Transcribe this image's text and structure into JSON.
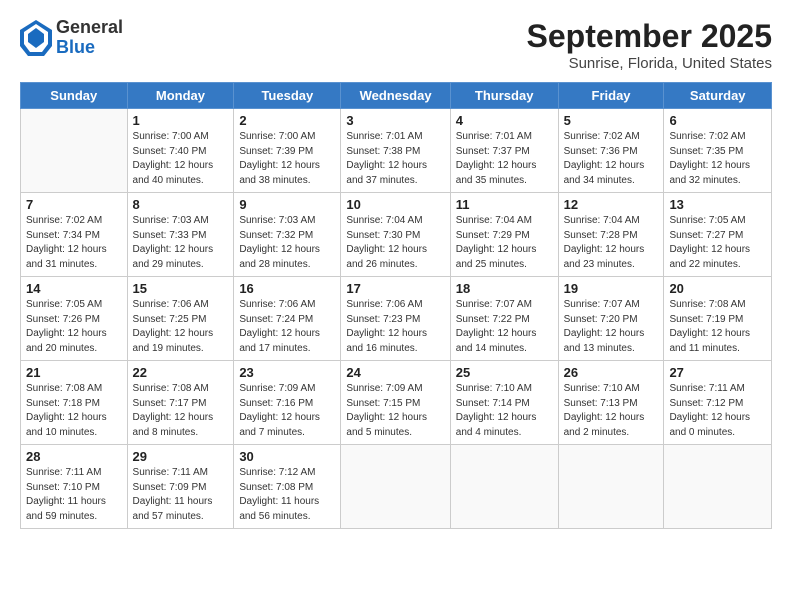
{
  "header": {
    "logo": {
      "general": "General",
      "blue": "Blue"
    },
    "title": "September 2025",
    "subtitle": "Sunrise, Florida, United States"
  },
  "weekdays": [
    "Sunday",
    "Monday",
    "Tuesday",
    "Wednesday",
    "Thursday",
    "Friday",
    "Saturday"
  ],
  "weeks": [
    [
      {
        "day": "",
        "info": ""
      },
      {
        "day": "1",
        "info": "Sunrise: 7:00 AM\nSunset: 7:40 PM\nDaylight: 12 hours\nand 40 minutes."
      },
      {
        "day": "2",
        "info": "Sunrise: 7:00 AM\nSunset: 7:39 PM\nDaylight: 12 hours\nand 38 minutes."
      },
      {
        "day": "3",
        "info": "Sunrise: 7:01 AM\nSunset: 7:38 PM\nDaylight: 12 hours\nand 37 minutes."
      },
      {
        "day": "4",
        "info": "Sunrise: 7:01 AM\nSunset: 7:37 PM\nDaylight: 12 hours\nand 35 minutes."
      },
      {
        "day": "5",
        "info": "Sunrise: 7:02 AM\nSunset: 7:36 PM\nDaylight: 12 hours\nand 34 minutes."
      },
      {
        "day": "6",
        "info": "Sunrise: 7:02 AM\nSunset: 7:35 PM\nDaylight: 12 hours\nand 32 minutes."
      }
    ],
    [
      {
        "day": "7",
        "info": "Sunrise: 7:02 AM\nSunset: 7:34 PM\nDaylight: 12 hours\nand 31 minutes."
      },
      {
        "day": "8",
        "info": "Sunrise: 7:03 AM\nSunset: 7:33 PM\nDaylight: 12 hours\nand 29 minutes."
      },
      {
        "day": "9",
        "info": "Sunrise: 7:03 AM\nSunset: 7:32 PM\nDaylight: 12 hours\nand 28 minutes."
      },
      {
        "day": "10",
        "info": "Sunrise: 7:04 AM\nSunset: 7:30 PM\nDaylight: 12 hours\nand 26 minutes."
      },
      {
        "day": "11",
        "info": "Sunrise: 7:04 AM\nSunset: 7:29 PM\nDaylight: 12 hours\nand 25 minutes."
      },
      {
        "day": "12",
        "info": "Sunrise: 7:04 AM\nSunset: 7:28 PM\nDaylight: 12 hours\nand 23 minutes."
      },
      {
        "day": "13",
        "info": "Sunrise: 7:05 AM\nSunset: 7:27 PM\nDaylight: 12 hours\nand 22 minutes."
      }
    ],
    [
      {
        "day": "14",
        "info": "Sunrise: 7:05 AM\nSunset: 7:26 PM\nDaylight: 12 hours\nand 20 minutes."
      },
      {
        "day": "15",
        "info": "Sunrise: 7:06 AM\nSunset: 7:25 PM\nDaylight: 12 hours\nand 19 minutes."
      },
      {
        "day": "16",
        "info": "Sunrise: 7:06 AM\nSunset: 7:24 PM\nDaylight: 12 hours\nand 17 minutes."
      },
      {
        "day": "17",
        "info": "Sunrise: 7:06 AM\nSunset: 7:23 PM\nDaylight: 12 hours\nand 16 minutes."
      },
      {
        "day": "18",
        "info": "Sunrise: 7:07 AM\nSunset: 7:22 PM\nDaylight: 12 hours\nand 14 minutes."
      },
      {
        "day": "19",
        "info": "Sunrise: 7:07 AM\nSunset: 7:20 PM\nDaylight: 12 hours\nand 13 minutes."
      },
      {
        "day": "20",
        "info": "Sunrise: 7:08 AM\nSunset: 7:19 PM\nDaylight: 12 hours\nand 11 minutes."
      }
    ],
    [
      {
        "day": "21",
        "info": "Sunrise: 7:08 AM\nSunset: 7:18 PM\nDaylight: 12 hours\nand 10 minutes."
      },
      {
        "day": "22",
        "info": "Sunrise: 7:08 AM\nSunset: 7:17 PM\nDaylight: 12 hours\nand 8 minutes."
      },
      {
        "day": "23",
        "info": "Sunrise: 7:09 AM\nSunset: 7:16 PM\nDaylight: 12 hours\nand 7 minutes."
      },
      {
        "day": "24",
        "info": "Sunrise: 7:09 AM\nSunset: 7:15 PM\nDaylight: 12 hours\nand 5 minutes."
      },
      {
        "day": "25",
        "info": "Sunrise: 7:10 AM\nSunset: 7:14 PM\nDaylight: 12 hours\nand 4 minutes."
      },
      {
        "day": "26",
        "info": "Sunrise: 7:10 AM\nSunset: 7:13 PM\nDaylight: 12 hours\nand 2 minutes."
      },
      {
        "day": "27",
        "info": "Sunrise: 7:11 AM\nSunset: 7:12 PM\nDaylight: 12 hours\nand 0 minutes."
      }
    ],
    [
      {
        "day": "28",
        "info": "Sunrise: 7:11 AM\nSunset: 7:10 PM\nDaylight: 11 hours\nand 59 minutes."
      },
      {
        "day": "29",
        "info": "Sunrise: 7:11 AM\nSunset: 7:09 PM\nDaylight: 11 hours\nand 57 minutes."
      },
      {
        "day": "30",
        "info": "Sunrise: 7:12 AM\nSunset: 7:08 PM\nDaylight: 11 hours\nand 56 minutes."
      },
      {
        "day": "",
        "info": ""
      },
      {
        "day": "",
        "info": ""
      },
      {
        "day": "",
        "info": ""
      },
      {
        "day": "",
        "info": ""
      }
    ]
  ]
}
